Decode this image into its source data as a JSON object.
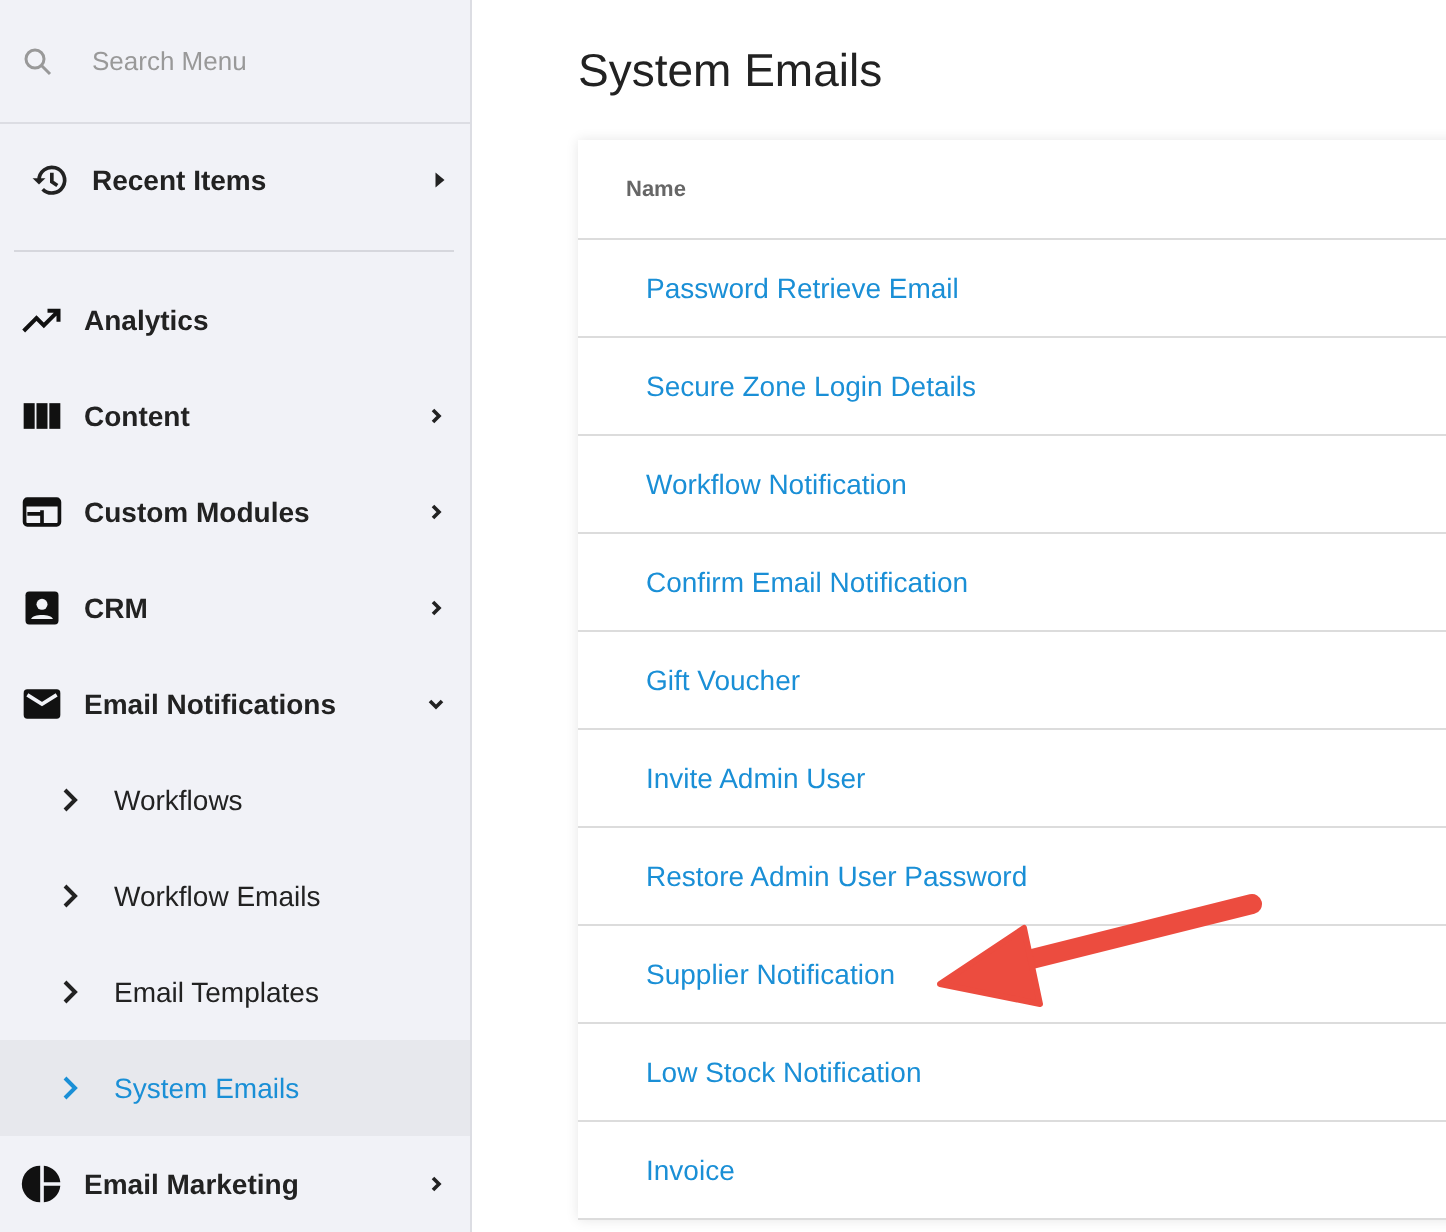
{
  "sidebar": {
    "search": {
      "placeholder": "Search Menu"
    },
    "recent": {
      "label": "Recent Items"
    },
    "items": [
      {
        "label": "Analytics",
        "kind": "link"
      },
      {
        "label": "Content",
        "kind": "group",
        "expanded": false
      },
      {
        "label": "Custom Modules",
        "kind": "group",
        "expanded": false
      },
      {
        "label": "CRM",
        "kind": "group",
        "expanded": false
      },
      {
        "label": "Email Notifications",
        "kind": "group",
        "expanded": true,
        "children": [
          {
            "label": "Workflows",
            "selected": false
          },
          {
            "label": "Workflow Emails",
            "selected": false
          },
          {
            "label": "Email Templates",
            "selected": false
          },
          {
            "label": "System Emails",
            "selected": true
          }
        ]
      },
      {
        "label": "Email Marketing",
        "kind": "group",
        "expanded": false
      }
    ]
  },
  "main": {
    "title": "System Emails",
    "table": {
      "columns": [
        "Name"
      ],
      "rows": [
        "Password Retrieve Email",
        "Secure Zone Login Details",
        "Workflow Notification",
        "Confirm Email Notification",
        "Gift Voucher",
        "Invite Admin User",
        "Restore Admin User Password",
        "Supplier Notification",
        "Low Stock Notification",
        "Invoice"
      ]
    }
  }
}
